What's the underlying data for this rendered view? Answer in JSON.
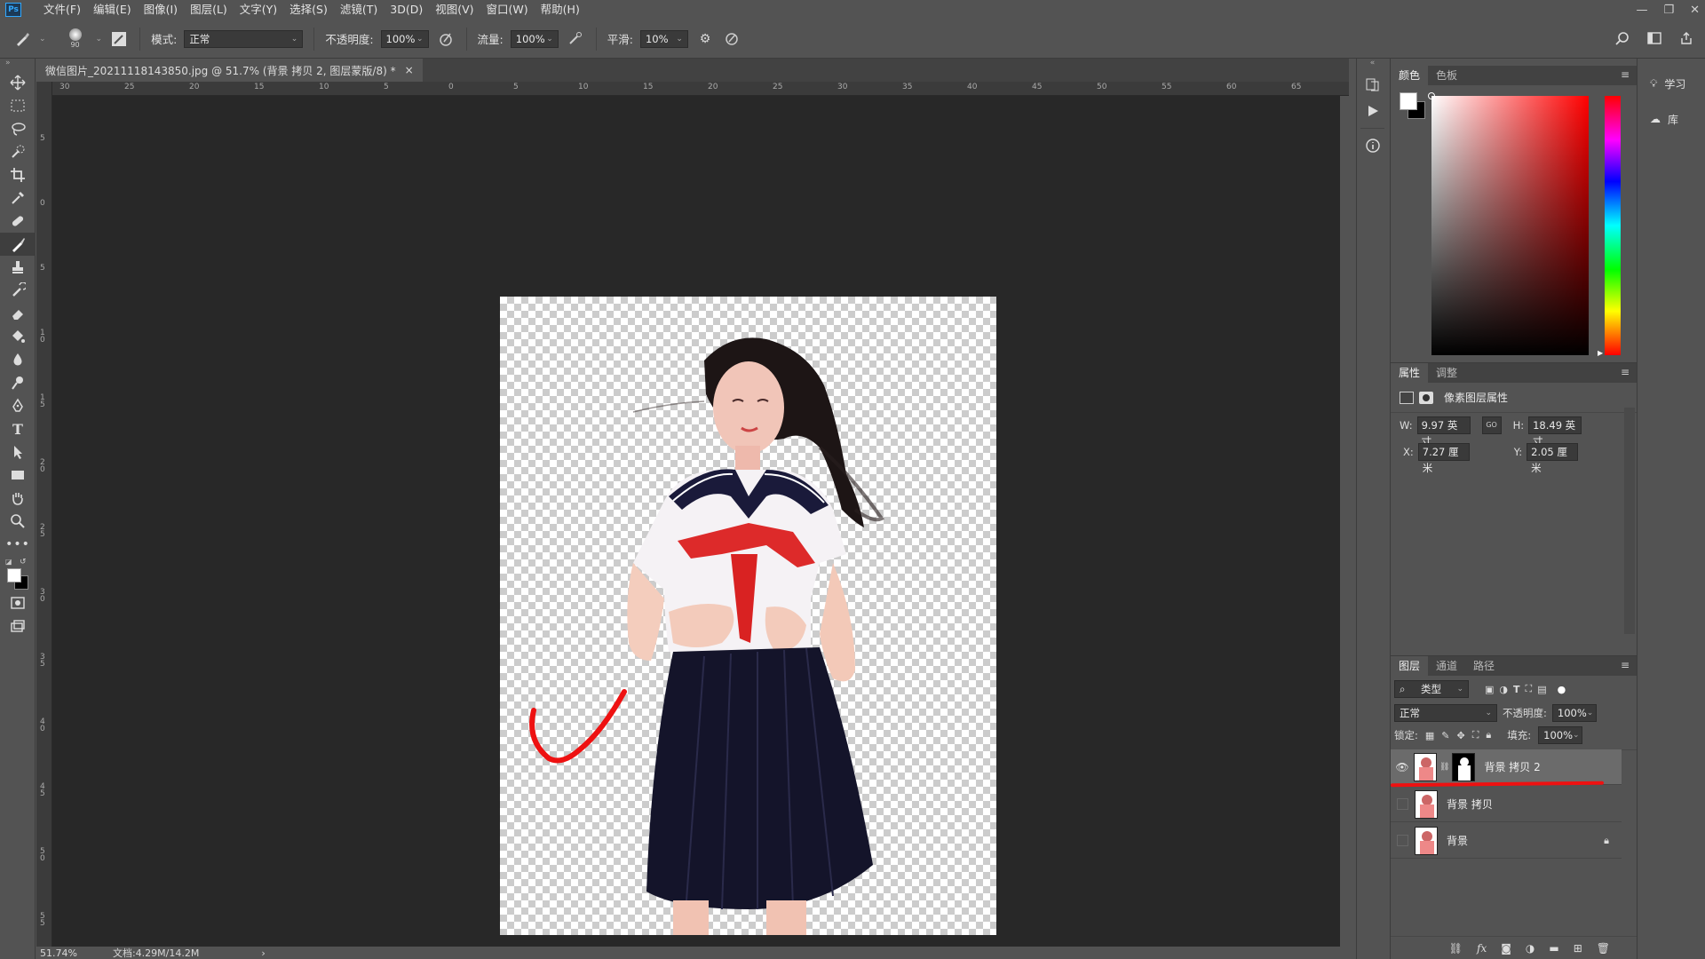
{
  "app": {
    "logo": "Ps"
  },
  "menu": [
    "文件(F)",
    "编辑(E)",
    "图像(I)",
    "图层(L)",
    "文字(Y)",
    "选择(S)",
    "滤镜(T)",
    "3D(D)",
    "视图(V)",
    "窗口(W)",
    "帮助(H)"
  ],
  "window_controls": {
    "minimize": "—",
    "restore": "❐",
    "close": "✕"
  },
  "options": {
    "brush_size": "90",
    "mode_label": "模式:",
    "mode_value": "正常",
    "opacity_label": "不透明度:",
    "opacity_value": "100%",
    "flow_label": "流量:",
    "flow_value": "100%",
    "smooth_label": "平滑:",
    "smooth_value": "10%"
  },
  "document": {
    "tab_title": "微信图片_20211118143850.jpg @ 51.7% (背景 拷贝 2, 图层蒙版/8) *",
    "close": "×"
  },
  "ruler_top": [
    "30",
    "25",
    "20",
    "15",
    "10",
    "5",
    "0",
    "5",
    "10",
    "15",
    "20",
    "25",
    "30",
    "35",
    "40",
    "45",
    "50",
    "55",
    "60",
    "65"
  ],
  "ruler_left": [
    "5",
    "0",
    "5",
    "10",
    "15",
    "20",
    "25",
    "30",
    "35",
    "40",
    "45",
    "50",
    "55"
  ],
  "status": {
    "zoom": "51.74%",
    "doc": "文档:4.29M/14.2M",
    "arrow": "›"
  },
  "color_panel": {
    "tabs": [
      "颜色",
      "色板"
    ],
    "fg_color": "#ffffff",
    "bg_color": "#000000",
    "picked_hue": "#ff0000"
  },
  "properties": {
    "tabs": [
      "属性",
      "调整"
    ],
    "title": "像素图层属性",
    "w_label": "W:",
    "w_value": "9.97 英寸",
    "h_label": "H:",
    "h_value": "18.49 英寸",
    "x_label": "X:",
    "x_value": "7.27 厘米",
    "y_label": "Y:",
    "y_value": "2.05 厘米",
    "link_icon": "GO"
  },
  "layers": {
    "tabs": [
      "图层",
      "通道",
      "路径"
    ],
    "filter_label": "类型",
    "blend_mode": "正常",
    "opacity_label": "不透明度:",
    "opacity_value": "100%",
    "lock_label": "锁定:",
    "fill_label": "填充:",
    "fill_value": "100%",
    "items": [
      {
        "name": "背景 拷贝 2",
        "visible": true,
        "selected": true,
        "has_mask": true
      },
      {
        "name": "背景 拷贝",
        "visible": false,
        "selected": false,
        "has_mask": false
      },
      {
        "name": "背景",
        "visible": false,
        "selected": false,
        "locked": true
      }
    ]
  },
  "learn_panel": {
    "learn": "学习",
    "library": "库"
  },
  "annotation_color": "#ee1111"
}
